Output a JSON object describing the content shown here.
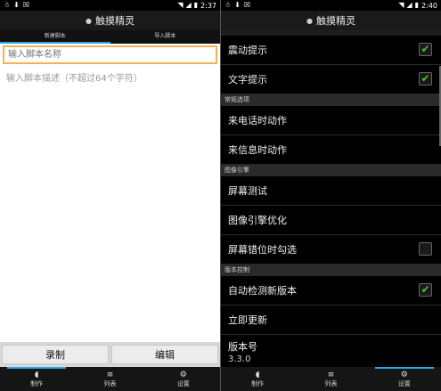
{
  "left": {
    "status": {
      "left_icons": [
        "☃",
        "⬇",
        "☒"
      ],
      "time": "2:37"
    },
    "title": "触摸精灵",
    "tabs": [
      {
        "label": "新建脚本",
        "active": true
      },
      {
        "label": "导入脚本",
        "active": false
      }
    ],
    "name_placeholder": "输入脚本名称",
    "desc_placeholder": "输入脚本描述（不超过64个字符）",
    "buttons": {
      "record": "录制",
      "edit": "编辑"
    },
    "nav": [
      {
        "label": "制作",
        "icon": "◖",
        "active": true
      },
      {
        "label": "列表",
        "icon": "≡",
        "active": false
      },
      {
        "label": "设置",
        "icon": "⚙",
        "active": false
      }
    ]
  },
  "right": {
    "status": {
      "left_icons": [
        "☃",
        "⬇",
        "☒"
      ],
      "time": "2:40"
    },
    "title": "触摸精灵",
    "settings": {
      "vibrate": {
        "label": "震动提示",
        "checked": true
      },
      "text_hint": {
        "label": "文字提示",
        "checked": true
      },
      "section_common": "常规选项",
      "call_action": "来电话时动作",
      "msg_action": "来信息时动作",
      "section_engine": "图像引擎",
      "screen_test": "屏幕测试",
      "engine_opt": "图像引擎优化",
      "misalign": {
        "label": "屏幕错位时勾选",
        "checked": false
      },
      "section_version": "版本控制",
      "auto_check": {
        "label": "自动检测新版本",
        "checked": true
      },
      "update_now": "立即更新",
      "version_label": "版本号",
      "version_value": "3.3.0"
    },
    "nav": [
      {
        "label": "制作",
        "icon": "◖",
        "active": false
      },
      {
        "label": "列表",
        "icon": "≡",
        "active": false
      },
      {
        "label": "设置",
        "icon": "⚙",
        "active": true
      }
    ]
  },
  "colors": {
    "accent": "#29a9e0",
    "check": "#4cc21a",
    "focus_border": "#f0b15a"
  }
}
